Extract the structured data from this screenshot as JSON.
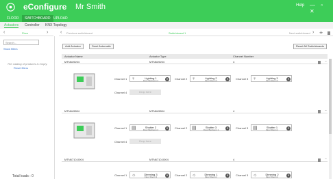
{
  "app": {
    "brand": "eConfigure",
    "project": "Mr Smith",
    "help": "Help",
    "window_buttons": "— ▫ ✕"
  },
  "nav": [
    "FLOOR",
    "SWITCHBOARD",
    "UPLOAD"
  ],
  "tabs": [
    "Actuators",
    "Controller",
    "KNX Topology"
  ],
  "floor": {
    "label": "Floor"
  },
  "switchboard": {
    "prev": "Previous switchboard",
    "current": "Switchboard 1",
    "next": "Next switchboard"
  },
  "left": {
    "search_placeholder": "Search...",
    "show_filters": "Show filters",
    "empty_text": "The catalog of products is empty.",
    "reset_filters": "Reset filters",
    "total_loads": "Total loads : 0"
  },
  "toolbar": {
    "add_actuator": "Add Actuator",
    "semi_automatic": "Semi Automatic",
    "reset_all": "Reset All Switchboards"
  },
  "table_headers": [
    "Actuator Name",
    "Actuator Type",
    "Channel Number"
  ],
  "actuators": [
    {
      "name": "MTN649204",
      "type": "MTN649204",
      "channels": "4",
      "loads": [
        {
          "channel": "Channel 1",
          "icon": "lightbulb-icon",
          "title": "Lighting 1",
          "room": "Floor Bedroom 2"
        },
        {
          "channel": "Channel 2",
          "icon": "lightbulb-icon",
          "title": "Lighting 2",
          "room": "Floor Room 2"
        },
        {
          "channel": "Channel 3",
          "icon": "lightbulb-icon",
          "title": "Lighting 3",
          "room": "Floor Room 3"
        }
      ],
      "channel4": "Channel 4",
      "drop": "Drop here"
    },
    {
      "name": "MTN649804",
      "type": "MTN649804",
      "channels": "4",
      "loads": [
        {
          "channel": "Channel 1",
          "icon": "shutter-icon",
          "title": "Shutter 2",
          "room": "Floor Bedroom 2"
        },
        {
          "channel": "Channel 2",
          "icon": "shutter-icon",
          "title": "Shutter 3",
          "room": "Floor Bedroom 1"
        },
        {
          "channel": "Channel 3",
          "icon": "shutter-icon",
          "title": "Shutter 1",
          "room": "Floor Room 1"
        }
      ],
      "channel4": "Channel 4",
      "drop": "Drop here"
    },
    {
      "name": "MTN6710-0004",
      "type": "MTN6710-0004",
      "channels": "4",
      "loads": [
        {
          "channel": "Channel 1",
          "icon": "dimmer-icon",
          "title": "Dimming 3",
          "room": "Floor Room 3"
        },
        {
          "channel": "Channel 2",
          "icon": "dimmer-icon",
          "title": "Dimming 1",
          "room": "Floor Room 1"
        },
        {
          "channel": "Channel 3",
          "icon": "dimmer-icon",
          "title": "Dimming 2",
          "room": "Floor Room 2"
        }
      ]
    }
  ],
  "colors": {
    "accent": "#3dcd58",
    "nav_active": "#2fa845"
  }
}
